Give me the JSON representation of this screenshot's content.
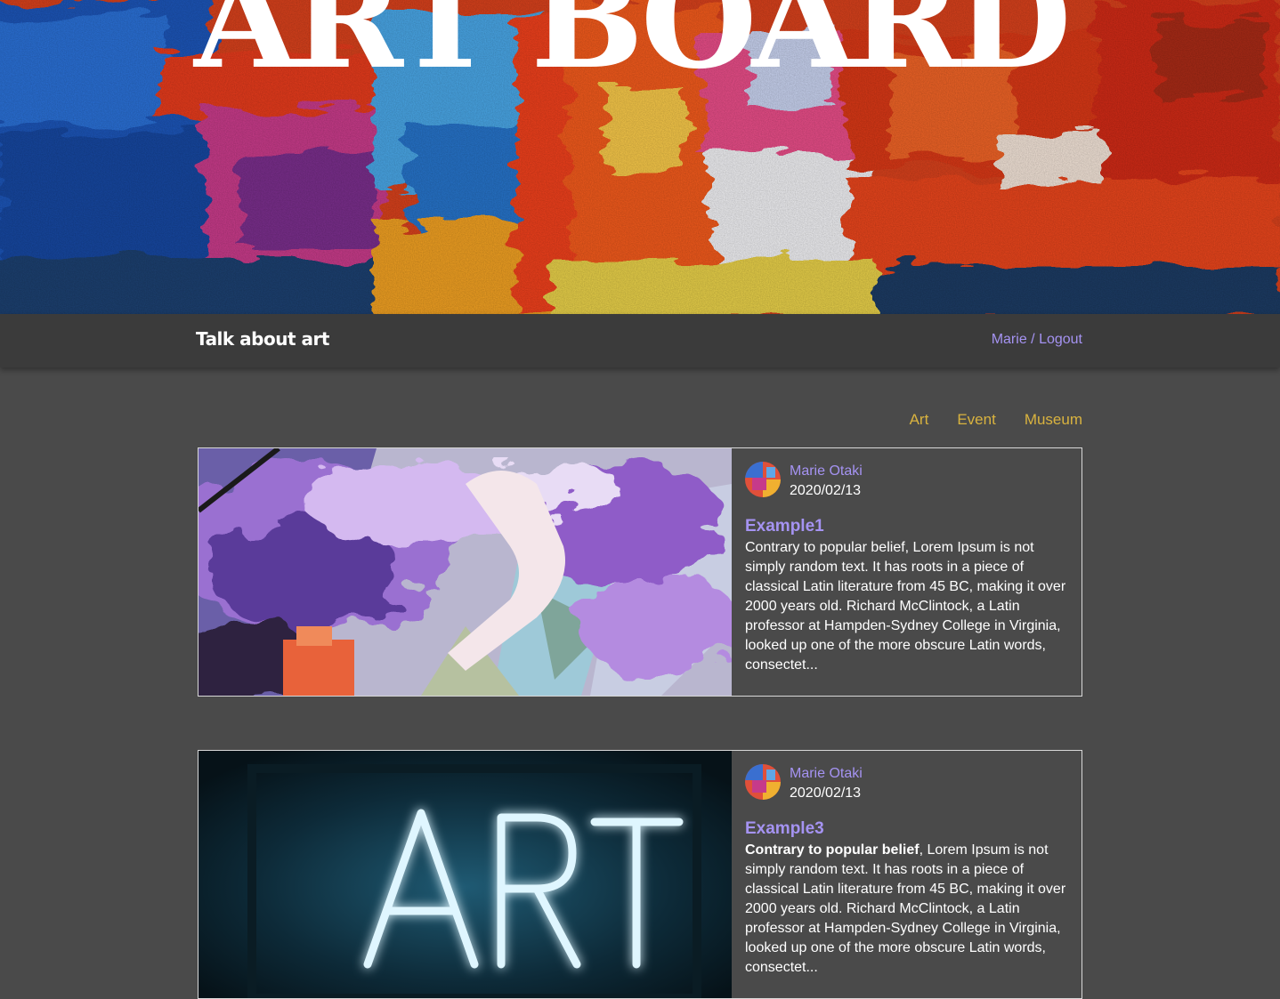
{
  "hero": {
    "title": "ART BOARD"
  },
  "navbar": {
    "brand": "Talk about art",
    "user_name": "Marie",
    "separator": " / ",
    "logout_label": "Logout"
  },
  "categories": [
    "Art",
    "Event",
    "Museum"
  ],
  "posts": [
    {
      "author": "Marie Otaki",
      "date": "2020/02/13",
      "title": "Example1",
      "excerpt_bold": "",
      "excerpt": "Contrary to popular belief, Lorem Ipsum is not simply random text. It has roots in a piece of classical Latin literature from 45 BC, making it over 2000 years old. Richard McClintock, a Latin professor at Hampden-Sydney College in Virginia, looked up one of the more obscure Latin words, consectet..."
    },
    {
      "author": "Marie Otaki",
      "date": "2020/02/13",
      "title": "Example3",
      "excerpt_bold": "Contrary to popular belief",
      "excerpt": ", Lorem Ipsum is not simply random text. It has roots in a piece of classical Latin literature from 45 BC, making it over 2000 years old. Richard McClintock, a Latin professor at Hampden-Sydney College in Virginia, looked up one of the more obscure Latin words, consectet..."
    }
  ],
  "colors": {
    "background": "#4a4a4a",
    "navbar": "#3b3b3b",
    "accent_purple": "#a593f2",
    "category_gold": "#d9b33f",
    "text": "#ffffff"
  }
}
